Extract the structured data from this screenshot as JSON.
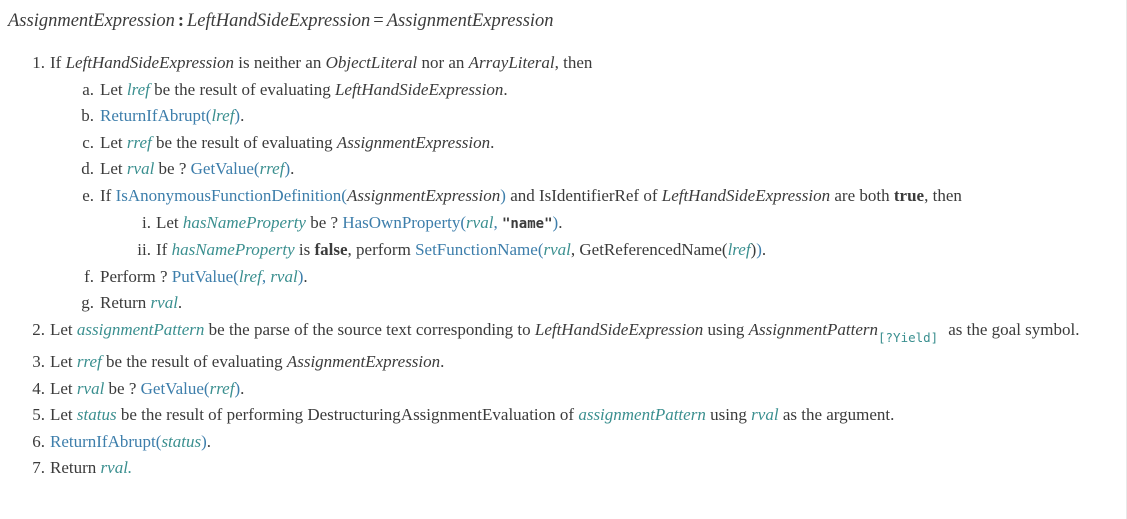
{
  "production": {
    "lhs": "AssignmentExpression",
    "colon": ":",
    "rhs_left": "LeftHandSideExpression",
    "equals": "=",
    "rhs_right": "AssignmentExpression"
  },
  "colors": {
    "text": "#3b3b3b",
    "variable": "#3a8f8f",
    "link": "#3d7eab",
    "background": "#ffffff",
    "border": "#e8e8e8"
  },
  "steps": [
    {
      "marker": "1.",
      "parts": [
        {
          "t": "If ",
          "k": "plain"
        },
        {
          "t": "LeftHandSideExpression",
          "k": "nt"
        },
        {
          "t": " is neither an ",
          "k": "plain"
        },
        {
          "t": "ObjectLiteral",
          "k": "nt"
        },
        {
          "t": " nor an ",
          "k": "plain"
        },
        {
          "t": "ArrayLiteral",
          "k": "nt"
        },
        {
          "t": ", then",
          "k": "plain"
        }
      ],
      "substeps": [
        {
          "marker": "a.",
          "parts": [
            {
              "t": "Let ",
              "k": "plain"
            },
            {
              "t": "lref",
              "k": "var"
            },
            {
              "t": " be the result of evaluating ",
              "k": "plain"
            },
            {
              "t": "LeftHandSideExpression",
              "k": "nt"
            },
            {
              "t": ".",
              "k": "plain"
            }
          ]
        },
        {
          "marker": "b.",
          "parts": [
            {
              "t": "ReturnIfAbrupt",
              "k": "aoid"
            },
            {
              "t": "(",
              "k": "aoid"
            },
            {
              "t": "lref",
              "k": "var"
            },
            {
              "t": ")",
              "k": "aoid"
            },
            {
              "t": ".",
              "k": "plain"
            }
          ]
        },
        {
          "marker": "c.",
          "parts": [
            {
              "t": "Let ",
              "k": "plain"
            },
            {
              "t": "rref",
              "k": "var"
            },
            {
              "t": " be the result of evaluating ",
              "k": "plain"
            },
            {
              "t": "AssignmentExpression",
              "k": "nt"
            },
            {
              "t": ".",
              "k": "plain"
            }
          ]
        },
        {
          "marker": "d.",
          "parts": [
            {
              "t": "Let ",
              "k": "plain"
            },
            {
              "t": "rval",
              "k": "var"
            },
            {
              "t": " be ? ",
              "k": "plain"
            },
            {
              "t": "GetValue",
              "k": "aoid"
            },
            {
              "t": "(",
              "k": "aoid"
            },
            {
              "t": "rref",
              "k": "var"
            },
            {
              "t": ")",
              "k": "aoid"
            },
            {
              "t": ".",
              "k": "plain"
            }
          ]
        },
        {
          "marker": "e.",
          "parts": [
            {
              "t": "If ",
              "k": "plain"
            },
            {
              "t": "IsAnonymousFunctionDefinition",
              "k": "aoid"
            },
            {
              "t": "(",
              "k": "aoid"
            },
            {
              "t": "AssignmentExpression",
              "k": "nt"
            },
            {
              "t": ")",
              "k": "aoid"
            },
            {
              "t": " and IsIdentifierRef of ",
              "k": "plain"
            },
            {
              "t": "LeftHandSideExpression",
              "k": "nt"
            },
            {
              "t": " are both ",
              "k": "plain"
            },
            {
              "t": "true",
              "k": "bool"
            },
            {
              "t": ", then",
              "k": "plain"
            }
          ],
          "substeps": [
            {
              "marker": "i.",
              "parts": [
                {
                  "t": "Let ",
                  "k": "plain"
                },
                {
                  "t": "hasNameProperty",
                  "k": "var"
                },
                {
                  "t": " be ? ",
                  "k": "plain"
                },
                {
                  "t": "HasOwnProperty",
                  "k": "aoid"
                },
                {
                  "t": "(",
                  "k": "aoid"
                },
                {
                  "t": "rval",
                  "k": "var"
                },
                {
                  "t": ", ",
                  "k": "aoid"
                },
                {
                  "t": "\"name\"",
                  "k": "str"
                },
                {
                  "t": ")",
                  "k": "aoid"
                },
                {
                  "t": ".",
                  "k": "plain"
                }
              ]
            },
            {
              "marker": "ii.",
              "parts": [
                {
                  "t": "If ",
                  "k": "plain"
                },
                {
                  "t": "hasNameProperty",
                  "k": "var"
                },
                {
                  "t": " is ",
                  "k": "plain"
                },
                {
                  "t": "false",
                  "k": "bool"
                },
                {
                  "t": ", perform ",
                  "k": "plain"
                },
                {
                  "t": "SetFunctionName",
                  "k": "aoid"
                },
                {
                  "t": "(",
                  "k": "aoid"
                },
                {
                  "t": "rval",
                  "k": "var"
                },
                {
                  "t": ", GetReferencedName(",
                  "k": "plain"
                },
                {
                  "t": "lref",
                  "k": "var"
                },
                {
                  "t": ")",
                  "k": "plain"
                },
                {
                  "t": ")",
                  "k": "aoid"
                },
                {
                  "t": ".",
                  "k": "plain"
                }
              ]
            }
          ]
        },
        {
          "marker": "f.",
          "parts": [
            {
              "t": "Perform ? ",
              "k": "plain"
            },
            {
              "t": "PutValue",
              "k": "aoid"
            },
            {
              "t": "(",
              "k": "aoid"
            },
            {
              "t": "lref",
              "k": "var"
            },
            {
              "t": ", ",
              "k": "aoid"
            },
            {
              "t": "rval",
              "k": "var"
            },
            {
              "t": ")",
              "k": "aoid"
            },
            {
              "t": ".",
              "k": "plain"
            }
          ]
        },
        {
          "marker": "g.",
          "parts": [
            {
              "t": "Return ",
              "k": "plain"
            },
            {
              "t": "rval",
              "k": "var"
            },
            {
              "t": ".",
              "k": "plain"
            }
          ]
        }
      ]
    },
    {
      "marker": "2.",
      "parts": [
        {
          "t": "Let ",
          "k": "plain"
        },
        {
          "t": "assignmentPattern",
          "k": "var"
        },
        {
          "t": " be the parse of the source text corresponding to ",
          "k": "plain"
        },
        {
          "t": "LeftHandSideExpression",
          "k": "nt"
        },
        {
          "t": " using ",
          "k": "plain"
        },
        {
          "t": "AssignmentPattern",
          "k": "nt"
        },
        {
          "t": "[?Yield]",
          "k": "sub"
        },
        {
          "t": " ",
          "k": "gap"
        },
        {
          "t": "as the goal symbol.",
          "k": "plain"
        }
      ]
    },
    {
      "marker": "3.",
      "parts": [
        {
          "t": "Let ",
          "k": "plain"
        },
        {
          "t": "rref",
          "k": "var"
        },
        {
          "t": " be the result of evaluating ",
          "k": "plain"
        },
        {
          "t": "AssignmentExpression",
          "k": "nt"
        },
        {
          "t": ".",
          "k": "plain"
        }
      ]
    },
    {
      "marker": "4.",
      "parts": [
        {
          "t": "Let ",
          "k": "plain"
        },
        {
          "t": "rval",
          "k": "var"
        },
        {
          "t": " be ? ",
          "k": "plain"
        },
        {
          "t": "GetValue",
          "k": "aoid"
        },
        {
          "t": "(",
          "k": "aoid"
        },
        {
          "t": "rref",
          "k": "var"
        },
        {
          "t": ")",
          "k": "aoid"
        },
        {
          "t": ".",
          "k": "plain"
        }
      ]
    },
    {
      "marker": "5.",
      "parts": [
        {
          "t": "Let ",
          "k": "plain"
        },
        {
          "t": "status",
          "k": "var"
        },
        {
          "t": " be the result of performing DestructuringAssignmentEvaluation of ",
          "k": "plain"
        },
        {
          "t": "assignmentPattern",
          "k": "var"
        },
        {
          "t": " using ",
          "k": "plain"
        },
        {
          "t": "rval",
          "k": "var"
        },
        {
          "t": " as the argument.",
          "k": "plain"
        }
      ]
    },
    {
      "marker": "6.",
      "parts": [
        {
          "t": "ReturnIfAbrupt",
          "k": "aoid"
        },
        {
          "t": "(",
          "k": "aoid"
        },
        {
          "t": "status",
          "k": "var"
        },
        {
          "t": ")",
          "k": "aoid"
        },
        {
          "t": ".",
          "k": "plain"
        }
      ]
    },
    {
      "marker": "7.",
      "parts": [
        {
          "t": "Return ",
          "k": "plain"
        },
        {
          "t": "rval",
          "k": "var"
        },
        {
          "t": ".",
          "k": "var"
        }
      ]
    }
  ]
}
